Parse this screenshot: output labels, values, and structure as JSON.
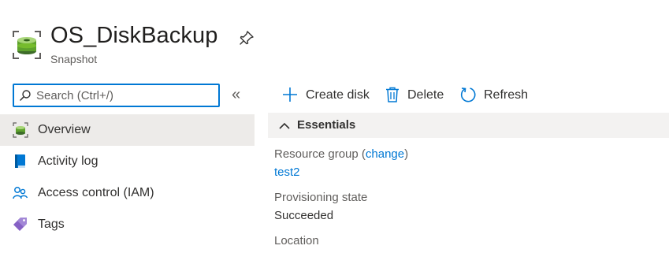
{
  "header": {
    "title": "OS_DiskBackup",
    "subtitle": "Snapshot",
    "icon": "snapshot-disk-icon",
    "pin_icon": "pin-icon"
  },
  "search": {
    "placeholder": "Search (Ctrl+/)",
    "value": ""
  },
  "sidebar": {
    "collapse_label": "«",
    "items": [
      {
        "label": "Overview",
        "icon": "overview-icon",
        "selected": true
      },
      {
        "label": "Activity log",
        "icon": "activity-log-icon",
        "selected": false
      },
      {
        "label": "Access control (IAM)",
        "icon": "iam-icon",
        "selected": false
      },
      {
        "label": "Tags",
        "icon": "tag-icon",
        "selected": false
      }
    ]
  },
  "toolbar": {
    "create_disk": "Create disk",
    "delete": "Delete",
    "refresh": "Refresh"
  },
  "essentials": {
    "heading": "Essentials",
    "resource_group_label": "Resource group (",
    "resource_group_change": "change",
    "resource_group_close": ")",
    "resource_group_value": "test2",
    "provisioning_state_label": "Provisioning state",
    "provisioning_state_value": "Succeeded",
    "location_label": "Location"
  },
  "colors": {
    "accent": "#0078d4",
    "selected_bg": "#edebe9",
    "essentials_bg": "#f3f2f1"
  }
}
